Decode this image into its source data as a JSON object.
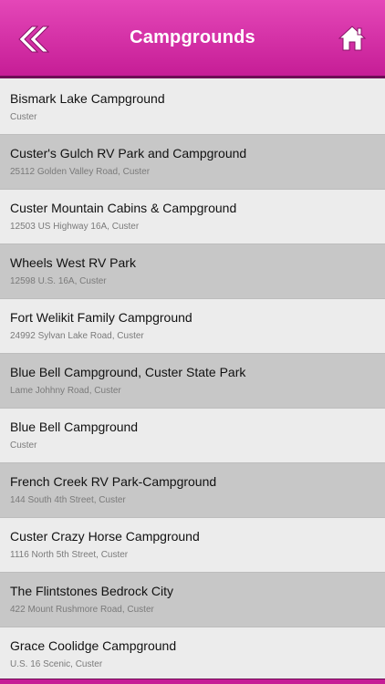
{
  "header": {
    "title": "Campgrounds",
    "back_icon": "double-chevron-left-icon",
    "home_icon": "home-icon",
    "accent_color": "#d42ea7"
  },
  "list": {
    "items": [
      {
        "title": "Bismark Lake Campground",
        "subtitle": "Custer"
      },
      {
        "title": "Custer's Gulch RV Park and Campground",
        "subtitle": "25112 Golden Valley Road, Custer"
      },
      {
        "title": "Custer Mountain Cabins & Campground",
        "subtitle": "12503 US Highway 16A, Custer"
      },
      {
        "title": "Wheels West RV Park",
        "subtitle": "12598 U.S. 16A, Custer"
      },
      {
        "title": "Fort Welikit Family Campground",
        "subtitle": "24992 Sylvan Lake Road, Custer"
      },
      {
        "title": "Blue Bell Campground, Custer State Park",
        "subtitle": "Lame Johhny Road, Custer"
      },
      {
        "title": "Blue Bell Campground",
        "subtitle": "Custer"
      },
      {
        "title": "French Creek RV Park-Campground",
        "subtitle": "144 South 4th Street, Custer"
      },
      {
        "title": "Custer Crazy Horse Campground",
        "subtitle": "1116 North 5th Street, Custer"
      },
      {
        "title": "The Flintstones Bedrock City",
        "subtitle": "422 Mount Rushmore Road, Custer"
      },
      {
        "title": "Grace Coolidge Campground",
        "subtitle": "U.S. 16 Scenic, Custer"
      }
    ]
  }
}
